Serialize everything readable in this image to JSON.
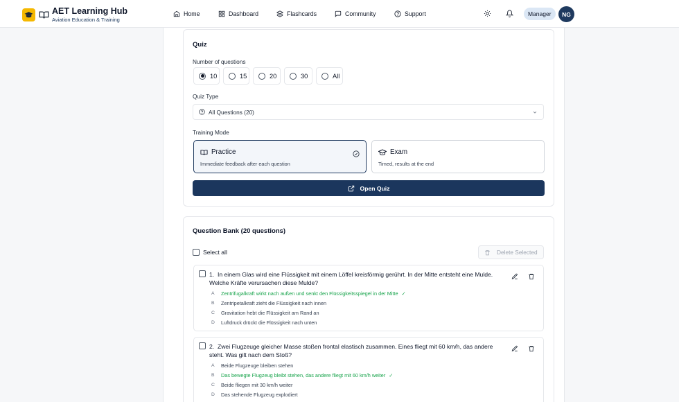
{
  "header": {
    "title": "AET Learning Hub",
    "subtitle": "Aviation Education & Training",
    "nav": [
      {
        "label": "Home",
        "icon": "home-icon"
      },
      {
        "label": "Dashboard",
        "icon": "grid-icon"
      },
      {
        "label": "Flashcards",
        "icon": "layers-icon"
      },
      {
        "label": "Community",
        "icon": "chat-icon"
      },
      {
        "label": "Support",
        "icon": "help-circle-icon"
      }
    ],
    "role": "Manager",
    "avatar_initials": "NG"
  },
  "quiz": {
    "title": "Quiz",
    "num_questions_label": "Number of questions",
    "num_options": [
      "10",
      "15",
      "20",
      "30",
      "All"
    ],
    "num_selected": "10",
    "type_label": "Quiz Type",
    "type_value": "All Questions (20)",
    "mode_label": "Training Mode",
    "modes": [
      {
        "title": "Practice",
        "desc": "Immediate feedback after each question",
        "selected": true
      },
      {
        "title": "Exam",
        "desc": "Timed, results at the end",
        "selected": false
      }
    ],
    "open_label": "Open Quiz"
  },
  "bank": {
    "title": "Question Bank (20 questions)",
    "select_all": "Select all",
    "delete_selected": "Delete Selected",
    "questions": [
      {
        "number": "1.",
        "text": "In einem Glas wird eine Flüssigkeit mit einem Löffel kreisförmig gerührt. In der Mitte entsteht eine Mulde. Welche Kräfte verursachen diese Mulde?",
        "answers": [
          {
            "letter": "A",
            "text": "Zentrifugalkraft wirkt nach außen und senkt den Flüssigkeitsspiegel in der Mitte",
            "correct": true
          },
          {
            "letter": "B",
            "text": "Zentripetalkraft zieht die Flüssigkeit nach innen",
            "correct": false
          },
          {
            "letter": "C",
            "text": "Gravitation hebt die Flüssigkeit am Rand an",
            "correct": false
          },
          {
            "letter": "D",
            "text": "Luftdruck drückt die Flüssigkeit nach unten",
            "correct": false
          }
        ]
      },
      {
        "number": "2.",
        "text": "Zwei Flugzeuge gleicher Masse stoßen frontal elastisch zusammen. Eines fliegt mit 60 km/h, das andere steht. Was gilt nach dem Stoß?",
        "answers": [
          {
            "letter": "A",
            "text": "Beide Flugzeuge bleiben stehen",
            "correct": false
          },
          {
            "letter": "B",
            "text": "Das bewegte Flugzeug bleibt stehen, das andere fliegt mit 60 km/h weiter",
            "correct": true
          },
          {
            "letter": "C",
            "text": "Beide fliegen mit 30 km/h weiter",
            "correct": false
          },
          {
            "letter": "D",
            "text": "Das stehende Flugzeug explodiert",
            "correct": false
          }
        ]
      }
    ]
  },
  "colors": {
    "accent": "#1b365d",
    "brand": "#f5b800",
    "correct": "#16a34a"
  }
}
